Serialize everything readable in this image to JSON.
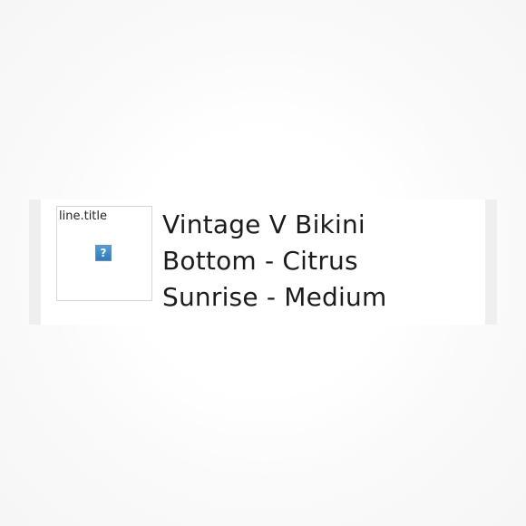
{
  "order_line": {
    "image_alt": "line.title",
    "broken_image_glyph": "?",
    "broken_image_icon": "broken-image-icon",
    "title": "Vintage V Bikini Bottom - Citrus Sunrise - Medium"
  },
  "colors": {
    "frame": "#efefef",
    "text": "#1c1c1c",
    "broken_icon": "#2e7bbf"
  }
}
